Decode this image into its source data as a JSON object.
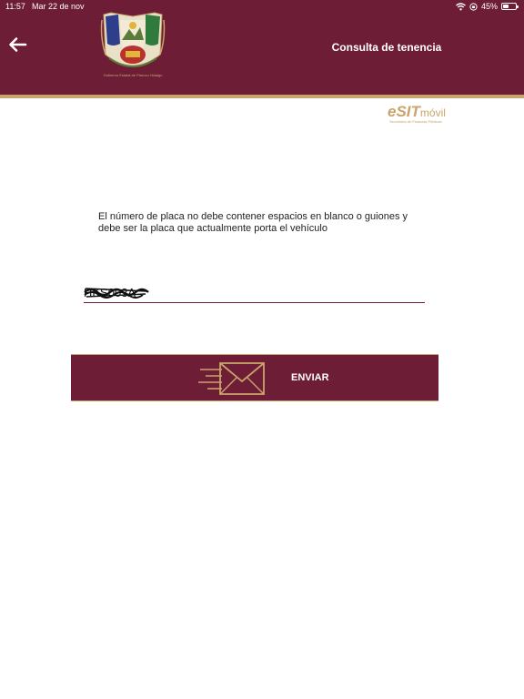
{
  "status_bar": {
    "time": "11:57",
    "date": "Mar 22 de nov",
    "battery": "45%",
    "battery_level": 0.45
  },
  "header": {
    "title": "Consulta de tenencia",
    "logo_caption": "Gobierno Estatal de Pánuco Hidalgo",
    "background_color": "#6e1d36",
    "accent_color": "#c9a46b"
  },
  "brand": {
    "e": "e",
    "sit": "SIT",
    "movil": "móvil",
    "subtitle": "Secretaría de Finanzas Públicas"
  },
  "form": {
    "instructions": "El número de placa no debe contener espacios en blanco o guiones y debe ser la placa que actualmente porta el vehículo",
    "plate_value": "HKS003A"
  },
  "actions": {
    "send_label": "ENVIAR"
  },
  "icons": {
    "back": "arrow-left-icon",
    "send": "envelope-send-icon",
    "wifi": "wifi-icon",
    "orientation_lock": "orientation-lock-icon",
    "battery": "battery-icon"
  }
}
